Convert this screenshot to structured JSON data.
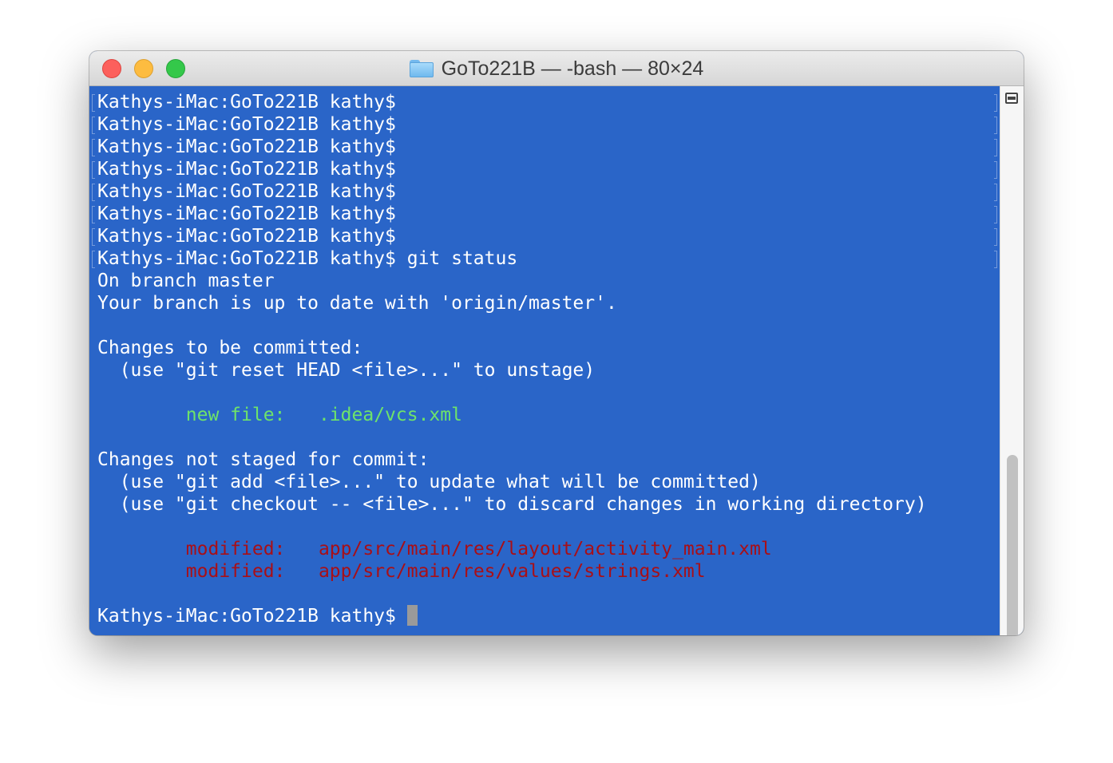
{
  "window": {
    "title": "GoTo221B — -bash — 80×24"
  },
  "terminal": {
    "prompt": "Kathys-iMac:GoTo221B kathy$",
    "history": [
      "Kathys-iMac:GoTo221B kathy$",
      "Kathys-iMac:GoTo221B kathy$",
      "Kathys-iMac:GoTo221B kathy$",
      "Kathys-iMac:GoTo221B kathy$",
      "Kathys-iMac:GoTo221B kathy$",
      "Kathys-iMac:GoTo221B kathy$",
      "Kathys-iMac:GoTo221B kathy$"
    ],
    "command": " git status",
    "branch_line": "On branch master",
    "uptodate_line": "Your branch is up to date with 'origin/master'.",
    "staged_header": "Changes to be committed:",
    "staged_hint": "  (use \"git reset HEAD <file>...\" to unstage)",
    "staged_file": {
      "status": "        new file:   ",
      "path": ".idea/vcs.xml"
    },
    "unstaged_header": "Changes not staged for commit:",
    "unstaged_hint_1": "  (use \"git add <file>...\" to update what will be committed)",
    "unstaged_hint_2": "  (use \"git checkout -- <file>...\" to discard changes in working directory)",
    "unstaged_files": [
      {
        "status": "        modified:   ",
        "path": "app/src/main/res/layout/activity_main.xml"
      },
      {
        "status": "        modified:   ",
        "path": "app/src/main/res/values/strings.xml"
      }
    ],
    "final_prompt": "Kathys-iMac:GoTo221B kathy$ "
  },
  "colors": {
    "background": "#2a65c8",
    "text": "#ffffff",
    "staged": "#6ee36a",
    "modified": "#a80f17",
    "cursor": "#9a9a9a"
  }
}
